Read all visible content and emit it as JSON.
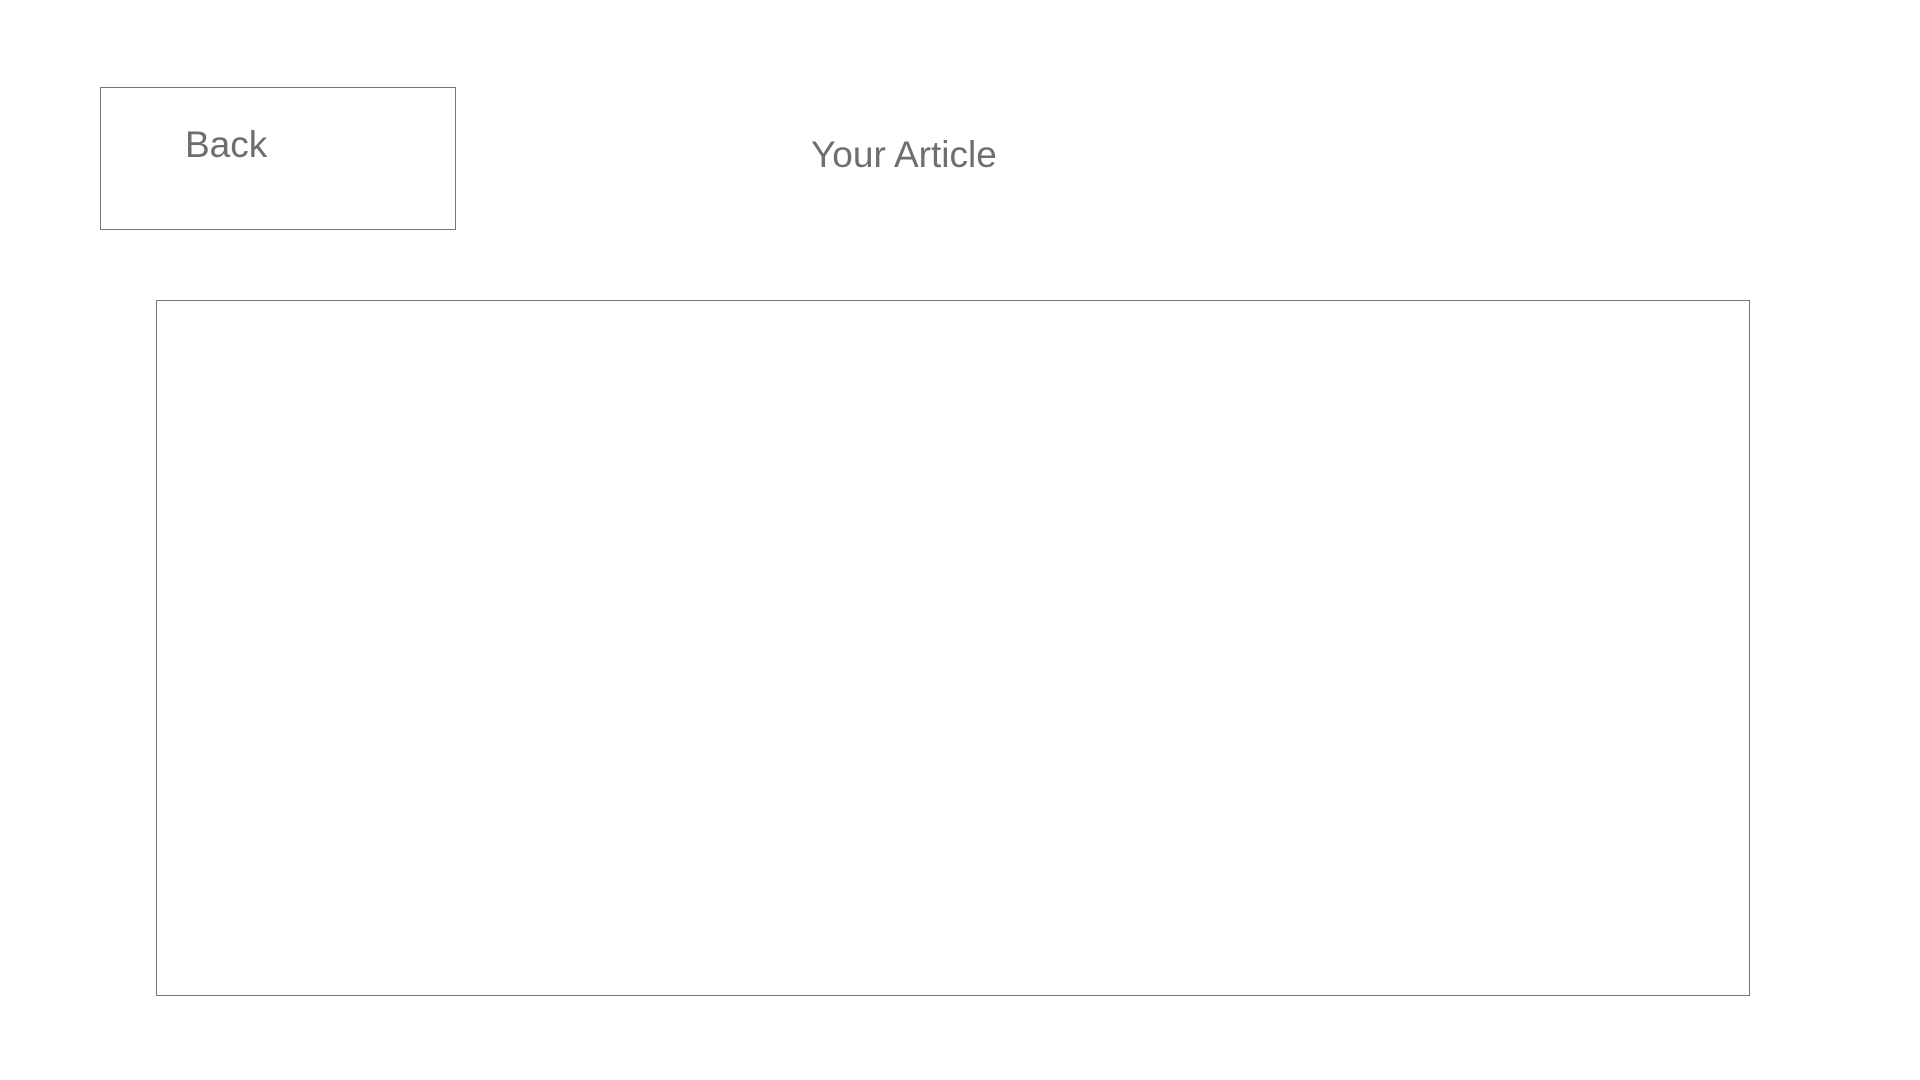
{
  "header": {
    "back_label": "Back",
    "title": "Your Article"
  },
  "article": {
    "content": ""
  }
}
